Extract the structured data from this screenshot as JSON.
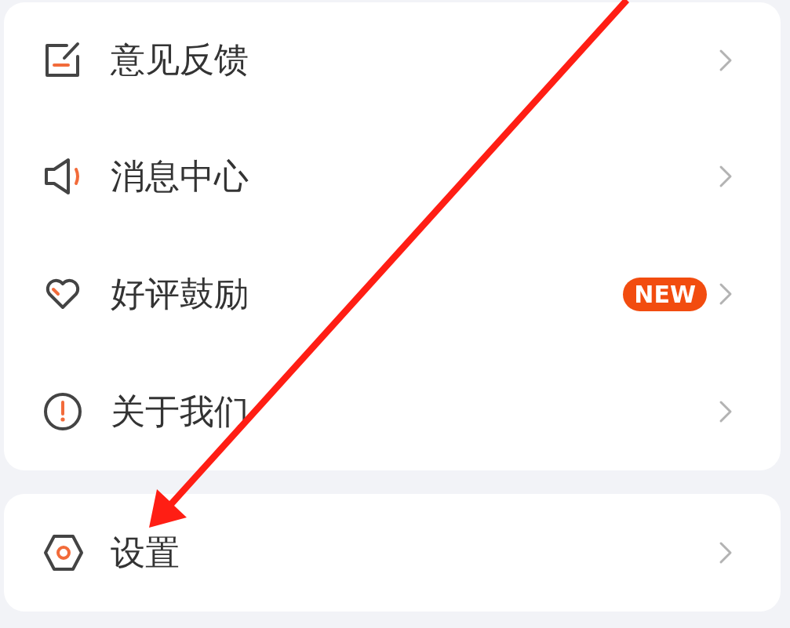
{
  "groups": [
    {
      "items": [
        {
          "kind": "feedback",
          "label": "意见反馈"
        },
        {
          "kind": "speaker",
          "label": "消息中心"
        },
        {
          "kind": "heart",
          "label": "好评鼓励",
          "badge": "NEW"
        },
        {
          "kind": "info",
          "label": "关于我们"
        }
      ]
    },
    {
      "items": [
        {
          "kind": "settings",
          "label": "设置"
        }
      ]
    }
  ]
}
